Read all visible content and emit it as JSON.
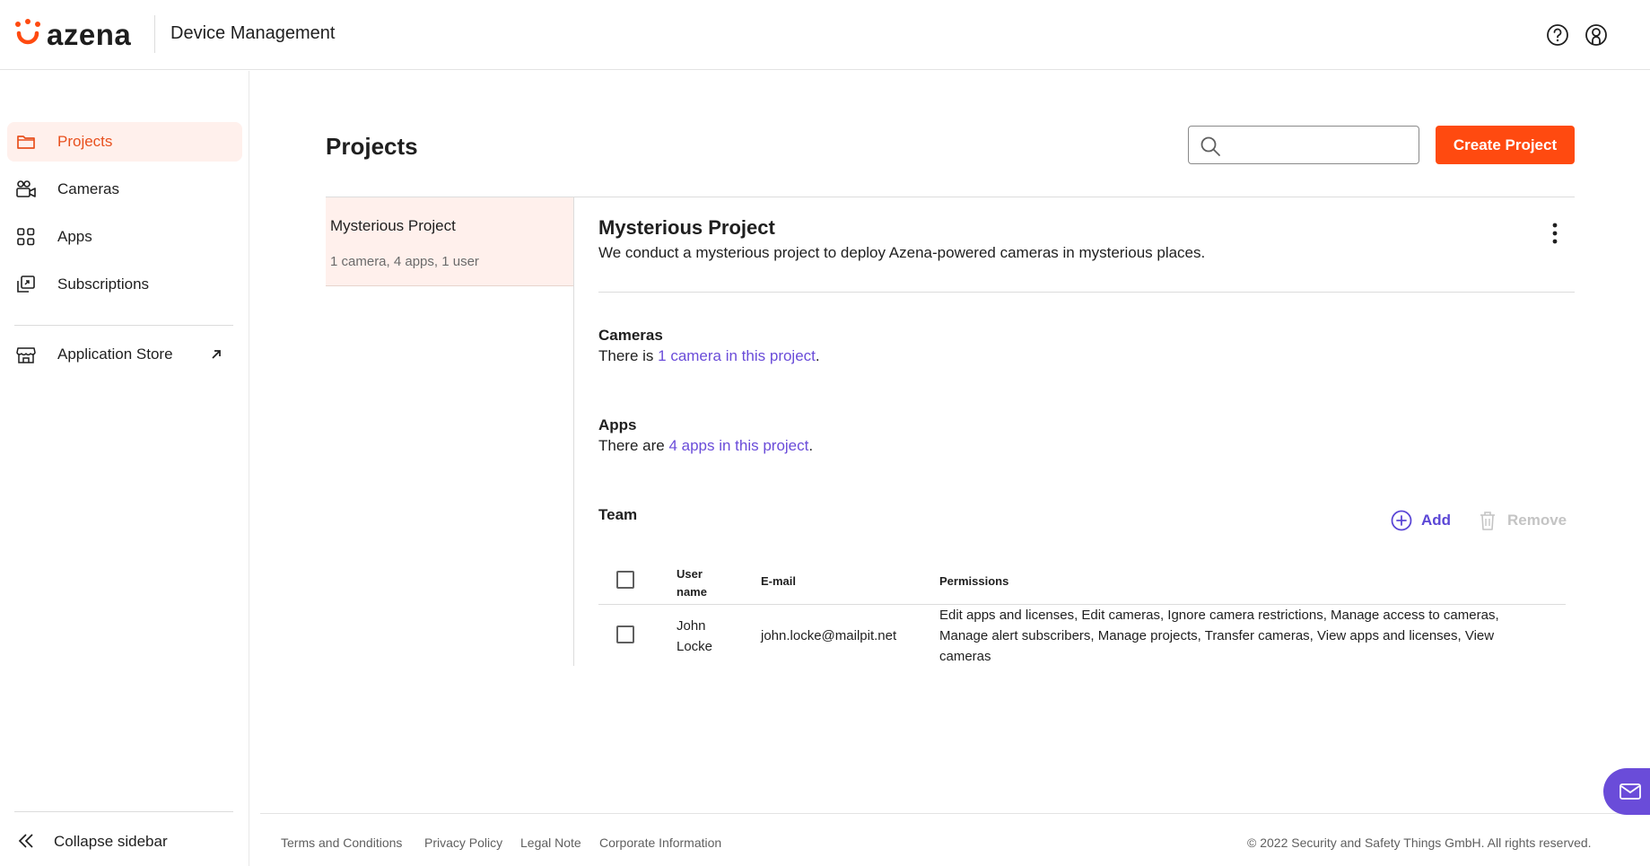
{
  "header": {
    "logo_text": "azena",
    "title": "Device Management",
    "icons": [
      "help-icon",
      "user-icon"
    ]
  },
  "colors": {
    "brand": "#ff4a10",
    "active_nav_bg": "#fff0ec",
    "link": "#6a4cd9"
  },
  "sidebar": {
    "items": [
      {
        "label": "Projects",
        "icon": "folder-icon",
        "active": true
      },
      {
        "label": "Cameras",
        "icon": "camera-icon",
        "active": false
      },
      {
        "label": "Apps",
        "icon": "apps-grid-icon",
        "active": false
      },
      {
        "label": "Subscriptions",
        "icon": "subscriptions-icon",
        "active": false
      }
    ],
    "store_label": "Application Store",
    "collapse_label": "Collapse sidebar"
  },
  "main": {
    "title": "Projects",
    "search_placeholder": "",
    "create_label": "Create Project"
  },
  "project_list": [
    {
      "name": "Mysterious Project",
      "meta": "1 camera, 4 apps, 1 user"
    }
  ],
  "detail": {
    "title": "Mysterious Project",
    "description": "We conduct a mysterious project to deploy Azena-powered cameras in mysterious places.",
    "cameras": {
      "heading": "Cameras",
      "prefix": "There is ",
      "link": "1 camera in this project",
      "suffix": "."
    },
    "apps": {
      "heading": "Apps",
      "prefix": "There are ",
      "link": "4 apps in this project",
      "suffix": "."
    },
    "team": {
      "heading": "Team",
      "add_label": "Add",
      "remove_label": "Remove",
      "columns": {
        "user_line1": "User",
        "user_line2": "name",
        "email": "E-mail",
        "permissions": "Permissions"
      },
      "rows": [
        {
          "first": "John",
          "last": "Locke",
          "email": "john.locke@mailpit.net",
          "perm_line1": "Edit apps and licenses, Edit cameras, Ignore camera restrictions, Manage access to cameras,",
          "perm_line2": "Manage alert subscribers, Manage projects, Transfer cameras, View apps and licenses, View",
          "perm_line3": "cameras"
        }
      ]
    }
  },
  "footer": {
    "links": [
      "Terms and Conditions",
      "Privacy Policy",
      "Legal Note",
      "Corporate Information"
    ],
    "copyright": "© 2022 Security and Safety Things GmbH. All rights reserved."
  }
}
